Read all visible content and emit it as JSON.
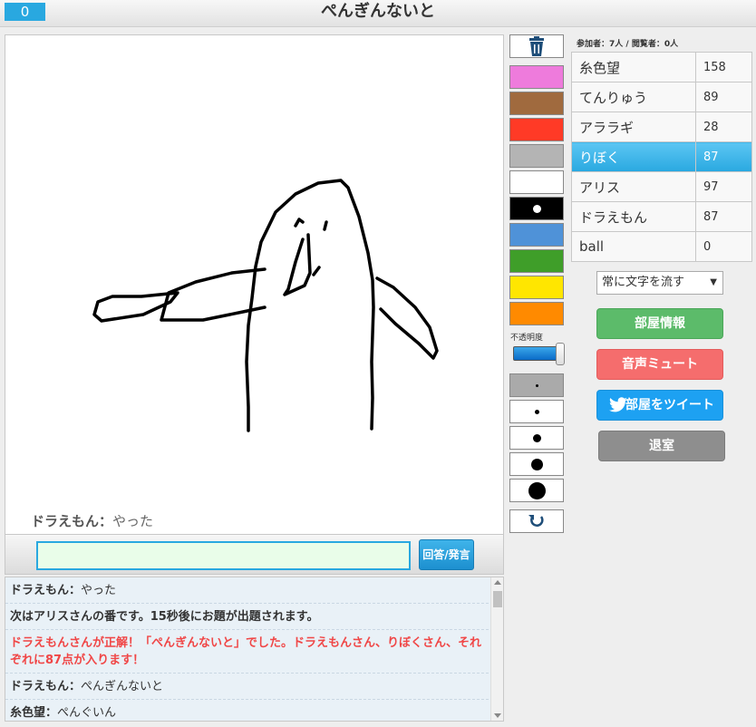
{
  "header": {
    "counter": "0",
    "title": "ぺんぎんないと"
  },
  "canvas": {
    "overlay_name": "ドラえもん：",
    "overlay_text": "やった"
  },
  "input": {
    "value": "",
    "send_label": "回答/発言"
  },
  "chat": [
    {
      "name": "ドラえもん：",
      "text": "やった",
      "kind": "user"
    },
    {
      "name": "",
      "text": "次はアリスさんの番です。15秒後にお題が出題されます。",
      "kind": "sys"
    },
    {
      "name": "",
      "text": "ドラえもんさんが正解！「ぺんぎんないと」でした。ドラえもんさん、りぼくさん、それぞれに87点が入ります！",
      "kind": "correct"
    },
    {
      "name": "ドラえもん：",
      "text": "ぺんぎんないと",
      "kind": "user"
    },
    {
      "name": "糸色望：",
      "text": "ぺんぐいん",
      "kind": "user"
    }
  ],
  "tools": {
    "trash_icon": "trash-icon",
    "colors": [
      "#ee7bdc",
      "#a06a3e",
      "#ff3a26",
      "#b4b4b4",
      "#ffffff",
      "#000000",
      "#4f92d8",
      "#3f9e29",
      "#ffe600",
      "#ff8a00"
    ],
    "opacity_label": "不透明度",
    "opacity_value": 1.0,
    "undo_icon": "undo-icon"
  },
  "room": {
    "counts": "参加者：7人 / 閲覧者：0人",
    "players": [
      {
        "name": "糸色望",
        "score": "158",
        "active": false
      },
      {
        "name": "てんりゅう",
        "score": "89",
        "active": false
      },
      {
        "name": "アララギ",
        "score": "28",
        "active": false
      },
      {
        "name": "りぼく",
        "score": "87",
        "active": true
      },
      {
        "name": "アリス",
        "score": "97",
        "active": false
      },
      {
        "name": "ドラえもん",
        "score": "87",
        "active": false
      },
      {
        "name": "ball",
        "score": "0",
        "active": false
      }
    ],
    "scroll_mode": "常に文字を流す",
    "info_label": "部屋情報",
    "mute_label": "音声ミュート",
    "tweet_label": "部屋をツイート",
    "exit_label": "退室"
  }
}
